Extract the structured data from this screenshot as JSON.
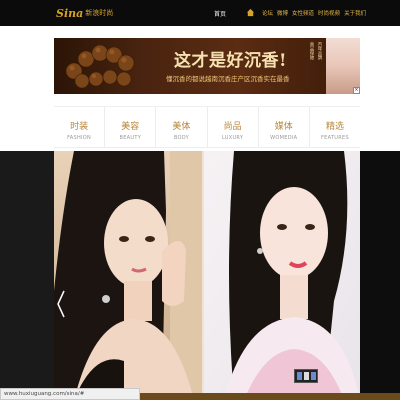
{
  "header": {
    "logo_mark": "Sina",
    "logo_text": "新浪时尚",
    "home_label": "首页",
    "nav_links": [
      "论坛",
      "微博",
      "女性频道",
      "时尚视频",
      "关于我们"
    ],
    "icon": "home-icon",
    "accent_color": "#d9a324"
  },
  "ad": {
    "headline": "这才是好沉香!",
    "subline": "懂沉香的都说越南沉香庄产区沉香实在最香",
    "side_columns": [
      "顶级原料",
      "百年品牌",
      "真品保障"
    ],
    "close_label": "×"
  },
  "categories": [
    {
      "cn": "时装",
      "en": "FASHION"
    },
    {
      "cn": "美容",
      "en": "BEAUTY"
    },
    {
      "cn": "美体",
      "en": "BODY"
    },
    {
      "cn": "尚品",
      "en": "LUXURY"
    },
    {
      "cn": "媒体",
      "en": "WOMEDIA"
    },
    {
      "cn": "精选",
      "en": "FEATURES"
    }
  ],
  "slideshow": {
    "prev_icon": "chevron-left-icon"
  },
  "status": {
    "url": "www.huxiuguang.com/sina/#"
  }
}
